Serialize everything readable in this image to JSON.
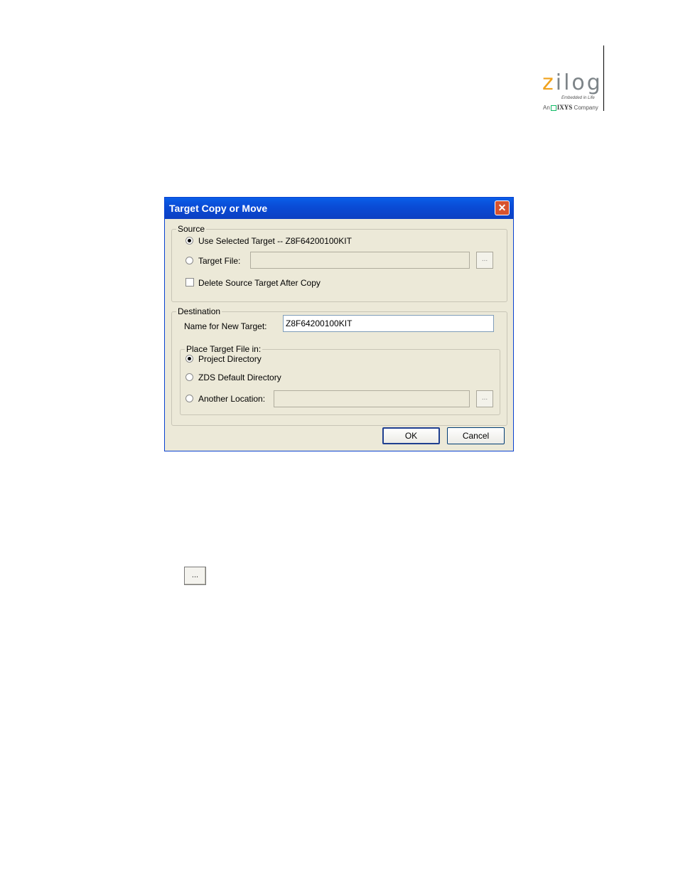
{
  "logo": {
    "word_accent": "z",
    "word_rest": "ilog",
    "tagline": "Embedded in Life",
    "company_prefix": "An",
    "company_brand": "IXYS",
    "company_suffix": "Company",
    "accent_color": "#f0a21c"
  },
  "dialog": {
    "title": "Target Copy or Move",
    "close_label": "✕",
    "source": {
      "legend": "Source",
      "use_selected_label": "Use Selected Target -- Z8F64200100KIT",
      "use_selected_checked": true,
      "target_file_label": "Target File:",
      "target_file_checked": false,
      "target_file_value": "",
      "browse_label": "...",
      "delete_source_label": "Delete Source Target After Copy",
      "delete_source_checked": false
    },
    "destination": {
      "legend": "Destination",
      "name_label": "Name for New Target:",
      "name_value": "Z8F64200100KIT",
      "place": {
        "legend": "Place Target File in:",
        "project_dir_label": "Project Directory",
        "project_dir_checked": true,
        "zds_default_label": "ZDS Default Directory",
        "zds_default_checked": false,
        "another_location_label": "Another Location:",
        "another_location_checked": false,
        "another_location_value": "",
        "browse_label": "..."
      }
    },
    "ok_label": "OK",
    "cancel_label": "Cancel"
  },
  "browse_sample_label": "..."
}
